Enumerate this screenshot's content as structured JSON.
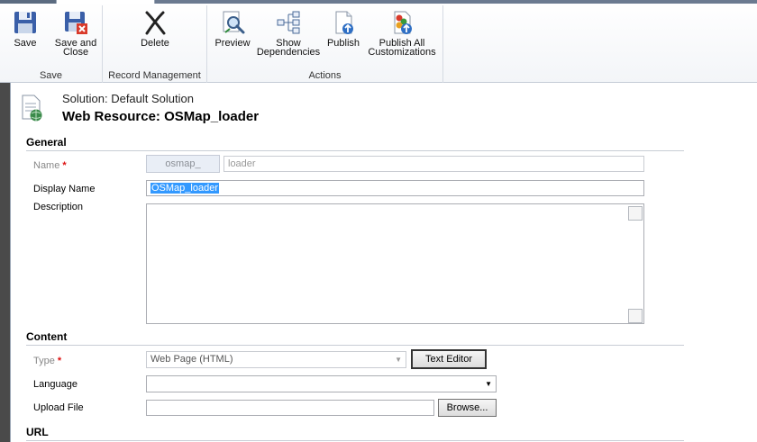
{
  "ribbon": {
    "groups": {
      "save": {
        "label": "Save",
        "buttons": {
          "save": "Save",
          "save_and_close_1": "Save and",
          "save_and_close_2": "Close"
        }
      },
      "record_management": {
        "label": "Record Management",
        "buttons": {
          "delete": "Delete"
        }
      },
      "actions": {
        "label": "Actions",
        "buttons": {
          "preview": "Preview",
          "show_dependencies_1": "Show",
          "show_dependencies_2": "Dependencies",
          "publish": "Publish",
          "publish_all_1": "Publish All",
          "publish_all_2": "Customizations"
        }
      }
    }
  },
  "header": {
    "solution": "Solution: Default Solution",
    "title": "Web Resource: OSMap_loader"
  },
  "general": {
    "title": "General",
    "name_label": "Name",
    "name_prefix": "osmap_",
    "name_value": "loader",
    "display_name_label": "Display Name",
    "display_name_value": "OSMap_loader",
    "description_label": "Description",
    "description_value": ""
  },
  "content": {
    "title": "Content",
    "type_label": "Type",
    "type_value": "Web Page (HTML)",
    "text_editor_button": "Text Editor",
    "language_label": "Language",
    "language_value": "",
    "upload_label": "Upload File",
    "upload_value": "",
    "browse_button": "Browse..."
  },
  "url": {
    "title": "URL"
  },
  "colors": {
    "selection": "#3399ff",
    "required": "#dd1111"
  }
}
